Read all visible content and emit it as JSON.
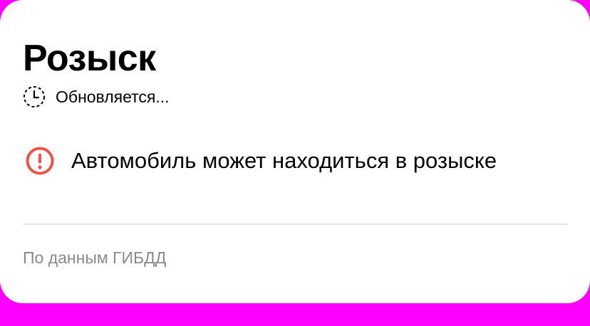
{
  "card": {
    "title": "Розыск",
    "status": {
      "icon": "clock-icon",
      "text": "Обновляется..."
    },
    "alert": {
      "icon": "exclamation-circle-icon",
      "icon_color": "#f0514b",
      "text": "Автомобиль может находиться в розыске"
    },
    "source": "По данным ГИБДД"
  },
  "colors": {
    "background": "#ff00ff",
    "card": "#ffffff",
    "secondary_text": "#8a8a8a",
    "divider": "#e6e6e6"
  }
}
